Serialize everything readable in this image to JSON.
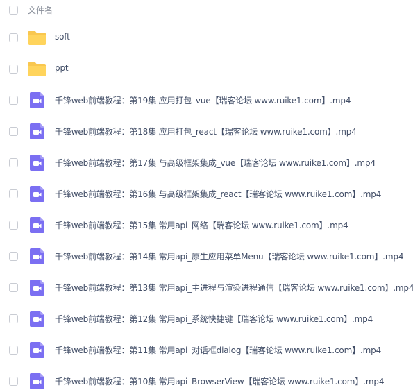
{
  "header": {
    "column_name": "文件名"
  },
  "colors": {
    "folder": "#f9c74f",
    "video": "#7b6ff2",
    "text": "#424e67",
    "header_text": "#888e99"
  },
  "files": [
    {
      "type": "folder",
      "icon": "folder-icon",
      "name": "soft"
    },
    {
      "type": "folder",
      "icon": "folder-icon",
      "name": "ppt"
    },
    {
      "type": "video",
      "icon": "video-file-icon",
      "name": "千锋web前端教程：第19集 应用打包_vue【瑞客论坛 www.ruike1.com】.mp4"
    },
    {
      "type": "video",
      "icon": "video-file-icon",
      "name": "千锋web前端教程：第18集 应用打包_react【瑞客论坛 www.ruike1.com】.mp4"
    },
    {
      "type": "video",
      "icon": "video-file-icon",
      "name": "千锋web前端教程：第17集 与高级框架集成_vue【瑞客论坛 www.ruike1.com】.mp4"
    },
    {
      "type": "video",
      "icon": "video-file-icon",
      "name": "千锋web前端教程：第16集 与高级框架集成_react【瑞客论坛 www.ruike1.com】.mp4"
    },
    {
      "type": "video",
      "icon": "video-file-icon",
      "name": "千锋web前端教程：第15集 常用api_网络【瑞客论坛 www.ruike1.com】.mp4"
    },
    {
      "type": "video",
      "icon": "video-file-icon",
      "name": "千锋web前端教程：第14集 常用api_原生应用菜单Menu【瑞客论坛 www.ruike1.com】.mp4"
    },
    {
      "type": "video",
      "icon": "video-file-icon",
      "name": "千锋web前端教程：第13集 常用api_主进程与渲染进程通信【瑞客论坛 www.ruike1.com】.mp4"
    },
    {
      "type": "video",
      "icon": "video-file-icon",
      "name": "千锋web前端教程：第12集 常用api_系统快捷键【瑞客论坛 www.ruike1.com】.mp4"
    },
    {
      "type": "video",
      "icon": "video-file-icon",
      "name": "千锋web前端教程：第11集 常用api_对话框dialog【瑞客论坛 www.ruike1.com】.mp4"
    },
    {
      "type": "video",
      "icon": "video-file-icon",
      "name": "千锋web前端教程：第10集 常用api_BrowserView【瑞客论坛 www.ruike1.com】.mp4"
    }
  ]
}
